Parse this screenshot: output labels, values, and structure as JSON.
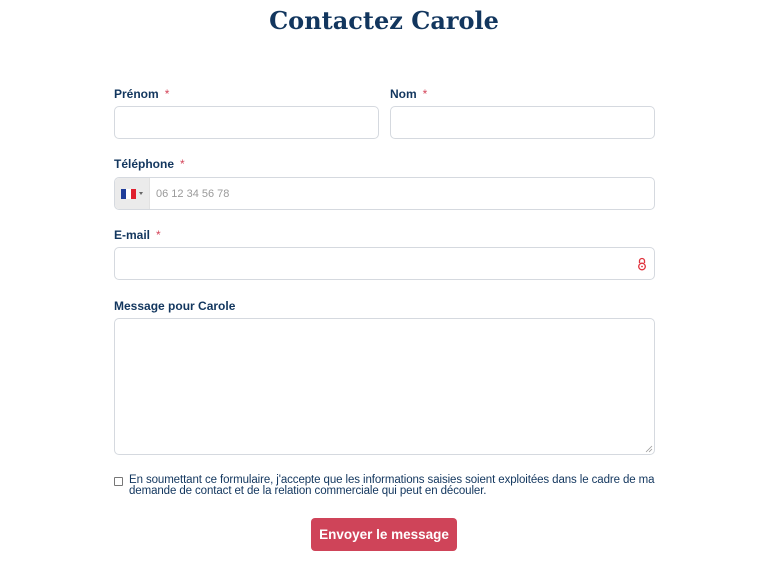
{
  "form": {
    "title": "Contactez Carole",
    "required_marker": "*",
    "fields": {
      "first_name": {
        "label": "Prénom",
        "value": ""
      },
      "last_name": {
        "label": "Nom",
        "value": ""
      },
      "phone": {
        "label": "Téléphone",
        "country": "FR",
        "placeholder": "06 12 34 56 78",
        "value": ""
      },
      "email": {
        "label": "E-mail",
        "value": ""
      },
      "message": {
        "label": "Message pour Carole",
        "value": ""
      }
    },
    "consent": {
      "checked": false,
      "text": "En soumettant ce formulaire, j'accepte que les informations saisies soient exploitées dans le cadre de ma demande de contact et de la relation commerciale qui peut en découler."
    },
    "submit_label": "Envoyer le message"
  },
  "colors": {
    "title": "#12365e",
    "required": "#d4455a",
    "button_bg": "#cf4459",
    "border": "#d5d9df"
  },
  "icons": {
    "flag": "france-flag-icon",
    "caret": "caret-down-icon",
    "email_field": "password-manager-icon",
    "resize": "resize-handle-icon"
  }
}
